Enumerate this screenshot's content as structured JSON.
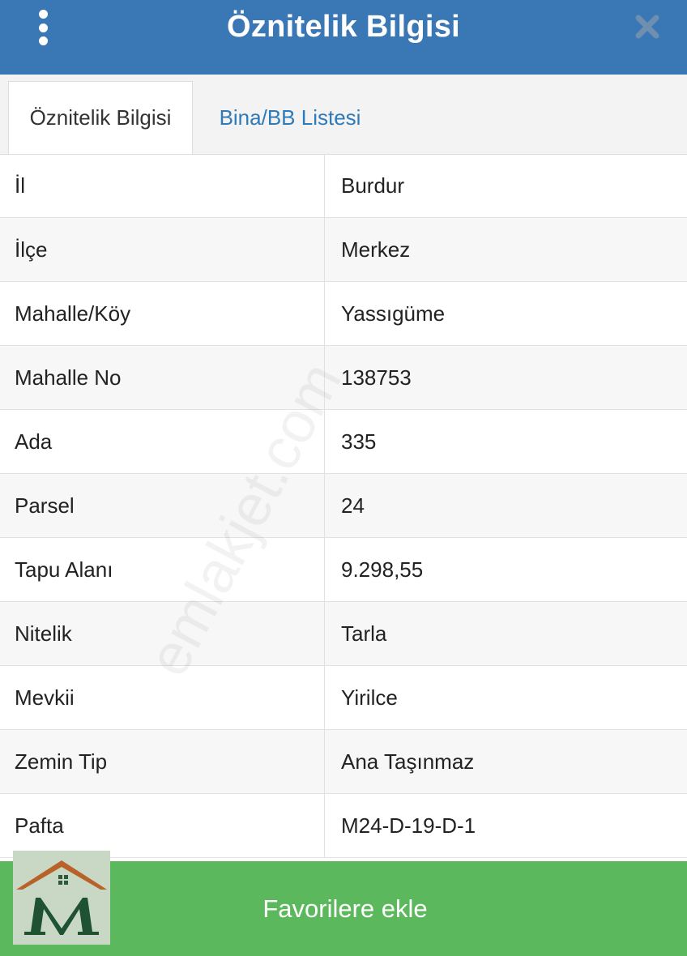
{
  "header": {
    "title": "Öznitelik Bilgisi",
    "background_color": "#3a77b5",
    "menu_icon": "kebab-menu-icon",
    "close_icon": "close-icon"
  },
  "tabs": [
    {
      "label": "Öznitelik Bilgisi",
      "active": true
    },
    {
      "label": "Bina/BB Listesi",
      "active": false
    }
  ],
  "attributes": [
    {
      "label": "İl",
      "value": "Burdur"
    },
    {
      "label": "İlçe",
      "value": "Merkez"
    },
    {
      "label": "Mahalle/Köy",
      "value": "Yassıgüme"
    },
    {
      "label": "Mahalle No",
      "value": "138753"
    },
    {
      "label": "Ada",
      "value": "335"
    },
    {
      "label": "Parsel",
      "value": "24"
    },
    {
      "label": "Tapu Alanı",
      "value": "9.298,55"
    },
    {
      "label": "Nitelik",
      "value": "Tarla"
    },
    {
      "label": "Mevkii",
      "value": "Yirilce"
    },
    {
      "label": "Zemin Tip",
      "value": "Ana Taşınmaz"
    },
    {
      "label": "Pafta",
      "value": "M24-D-19-D-1"
    }
  ],
  "footer": {
    "favorites_label": "Favorilere ekle",
    "button_color": "#5cb85c"
  },
  "watermark": {
    "text": "emlakjet.com"
  },
  "logo": {
    "icon": "house-m-logo-icon"
  }
}
